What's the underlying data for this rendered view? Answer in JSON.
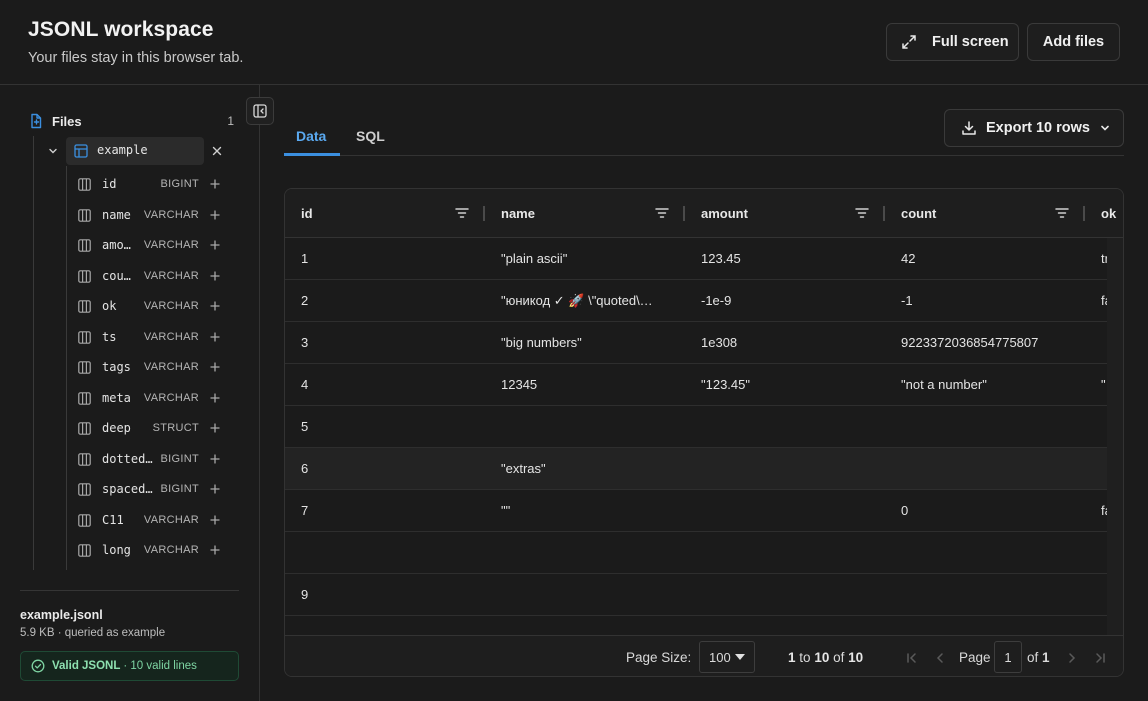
{
  "header": {
    "title": "JSONL workspace",
    "subtitle": "Your files stay in this browser tab.",
    "fullscreen_label": "Full screen",
    "add_files_label": "Add files"
  },
  "sidebar": {
    "files_label": "Files",
    "files_count": "1",
    "table_name": "example",
    "columns": [
      {
        "name": "id",
        "type": "BIGINT"
      },
      {
        "name": "name",
        "type": "VARCHAR"
      },
      {
        "name": "amo…",
        "type": "VARCHAR"
      },
      {
        "name": "cou…",
        "type": "VARCHAR"
      },
      {
        "name": "ok",
        "type": "VARCHAR"
      },
      {
        "name": "ts",
        "type": "VARCHAR"
      },
      {
        "name": "tags",
        "type": "VARCHAR"
      },
      {
        "name": "meta",
        "type": "VARCHAR"
      },
      {
        "name": "deep",
        "type": "STRUCT"
      },
      {
        "name": "dotted…",
        "type": "BIGINT"
      },
      {
        "name": "spaced…",
        "type": "BIGINT"
      },
      {
        "name": "C11",
        "type": "VARCHAR"
      },
      {
        "name": "long",
        "type": "VARCHAR"
      }
    ],
    "file_name": "example.jsonl",
    "file_meta": "5.9 KB · queried as example",
    "valid_label": "Valid JSONL",
    "valid_detail": "· 10 valid lines"
  },
  "tabs": {
    "data": "Data",
    "sql": "SQL"
  },
  "export_label": "Export 10 rows",
  "grid": {
    "headers": [
      "id",
      "name",
      "amount",
      "count",
      "ok"
    ],
    "rows": [
      [
        "1",
        "\"plain ascii\"",
        "123.45",
        "42",
        "tr"
      ],
      [
        "2",
        "\"юникод ✓ 🚀 \\\"quoted\\…",
        "-1e-9",
        "-1",
        "fa"
      ],
      [
        "3",
        "\"big numbers\"",
        "1e308",
        "9223372036854775807",
        ""
      ],
      [
        "4",
        "12345",
        "\"123.45\"",
        "\"not a number\"",
        "\""
      ],
      [
        "5",
        "",
        "",
        "",
        ""
      ],
      [
        "6",
        "\"extras\"",
        "",
        "",
        ""
      ],
      [
        "7",
        "\"\"",
        "",
        "0",
        "fa"
      ],
      [
        "",
        "",
        "",
        "",
        ""
      ],
      [
        "9",
        "",
        "",
        "",
        ""
      ]
    ]
  },
  "footer": {
    "page_size_label": "Page Size:",
    "page_size": "100",
    "range_from": "1",
    "range_to_word": "to",
    "range_to": "10",
    "range_of_word": "of",
    "range_total": "10",
    "page_label": "Page",
    "page_value": "1",
    "of_label": "of",
    "page_total": "1"
  },
  "colors": {
    "accent": "#3b8fe0",
    "valid_green": "#7ed5a3"
  }
}
